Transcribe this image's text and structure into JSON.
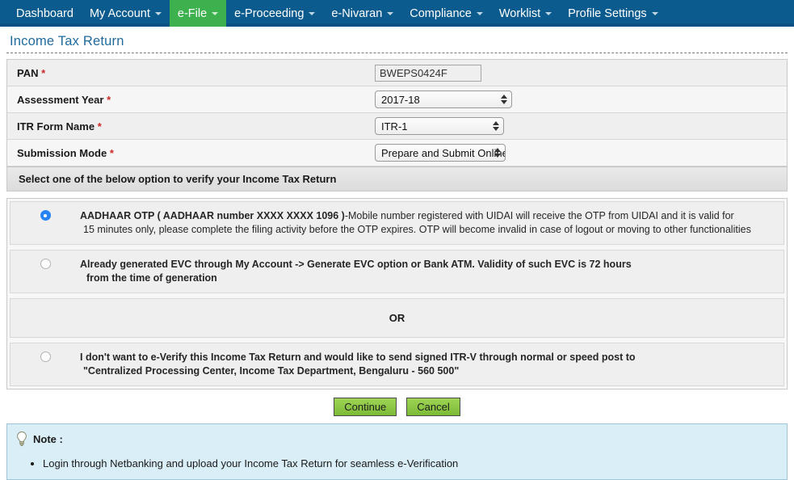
{
  "nav": {
    "items": [
      {
        "label": "Dashboard",
        "caret": false,
        "active": false
      },
      {
        "label": "My Account",
        "caret": true,
        "active": false
      },
      {
        "label": "e-File",
        "caret": true,
        "active": true
      },
      {
        "label": "e-Proceeding",
        "caret": true,
        "active": false
      },
      {
        "label": "e-Nivaran",
        "caret": true,
        "active": false
      },
      {
        "label": "Compliance",
        "caret": true,
        "active": false
      },
      {
        "label": "Worklist",
        "caret": true,
        "active": false
      },
      {
        "label": "Profile Settings",
        "caret": true,
        "active": false
      }
    ]
  },
  "page": {
    "title": "Income Tax Return"
  },
  "form": {
    "rows": [
      {
        "label": "PAN",
        "required": true,
        "control": "text",
        "value": "BWEPS0424F"
      },
      {
        "label": "Assessment Year",
        "required": true,
        "control": "select",
        "value": "2017-18"
      },
      {
        "label": "ITR Form Name",
        "required": true,
        "control": "select",
        "value": "ITR-1"
      },
      {
        "label": "Submission Mode",
        "required": true,
        "control": "select",
        "value": "Prepare and Submit Online"
      }
    ],
    "section_header": "Select one of the below option to verify your Income Tax Return"
  },
  "options": {
    "or_label": "OR",
    "items": [
      {
        "selected": true,
        "bold_text": "AADHAAR OTP ( AADHAAR number XXXX XXXX 1096 )",
        "rest_text": "-Mobile number registered with UIDAI will receive the OTP from UIDAI and it is valid for",
        "line2": "15 minutes only, please complete the filing activity before the OTP expires. OTP will become invalid in case of logout or moving to other functionalities"
      },
      {
        "selected": false,
        "bold_text": "Already generated EVC through My Account -> Generate EVC option or Bank ATM. Validity of such EVC is 72 hours",
        "rest_text": "",
        "line2": "from the time of generation"
      },
      {
        "selected": false,
        "bold_text": "I don't want to e-Verify this Income Tax Return and would like to send signed ITR-V through normal or speed post to",
        "rest_text": "",
        "line2": "\"Centralized Processing Center, Income Tax Department, Bengaluru - 560 500\""
      }
    ]
  },
  "buttons": {
    "continue": "Continue",
    "cancel": "Cancel"
  },
  "note": {
    "heading": "Note :",
    "items": [
      "Login through Netbanking and upload your Income Tax Return for seamless e-Verification"
    ]
  },
  "colors": {
    "nav_blue": "#0b5b8e",
    "active_green": "#3eb14f",
    "title_blue": "#1f6a9c",
    "button_green": "#8dc63f",
    "note_blue": "#d9eef7",
    "required_red": "#cc2b2b",
    "radio_blue": "#2684f5"
  }
}
